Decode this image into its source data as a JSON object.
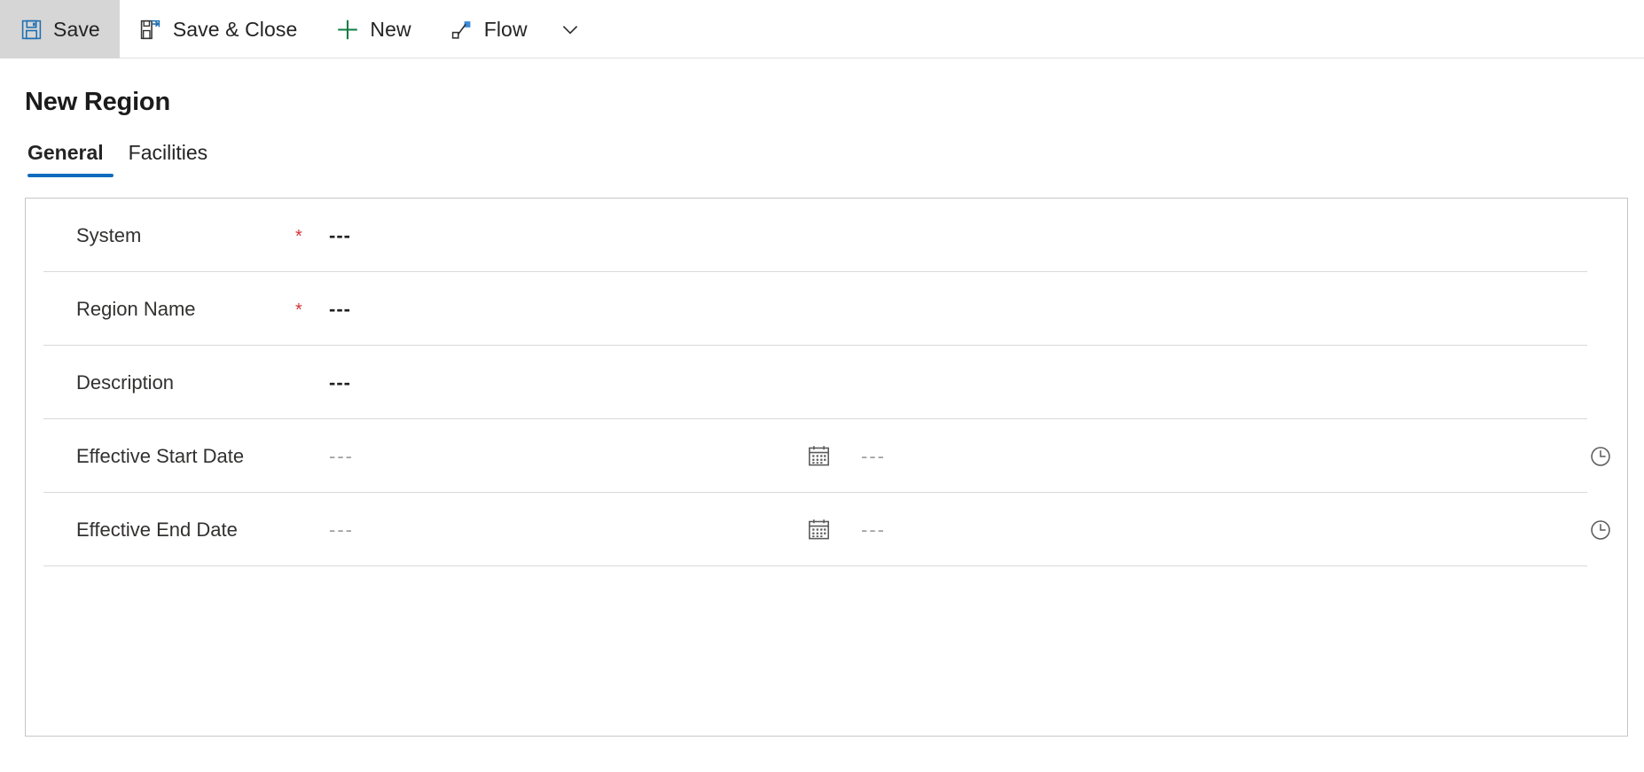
{
  "commandbar": {
    "items": [
      {
        "label": "Save",
        "icon": "save-icon",
        "active": true
      },
      {
        "label": "Save & Close",
        "icon": "save-and-close-icon",
        "active": false
      },
      {
        "label": "New",
        "icon": "plus-icon",
        "active": false
      },
      {
        "label": "Flow",
        "icon": "flow-icon",
        "active": false
      }
    ],
    "overflow_icon": "chevron-down-icon"
  },
  "header": {
    "title": "New Region"
  },
  "tabs": [
    {
      "label": "General",
      "selected": true
    },
    {
      "label": "Facilities",
      "selected": false
    }
  ],
  "form": {
    "rows": [
      {
        "label": "System",
        "required": "*",
        "value": "---",
        "type": "lookup"
      },
      {
        "label": "Region Name",
        "required": "*",
        "value": "---",
        "type": "text"
      },
      {
        "label": "Description",
        "required": "",
        "value": "---",
        "type": "text"
      },
      {
        "label": "Effective Start Date",
        "required": "",
        "value": "---",
        "time_value": "---",
        "type": "datetime",
        "date_icon": "calendar-icon",
        "time_icon": "clock-icon"
      },
      {
        "label": "Effective End Date",
        "required": "",
        "value": "---",
        "time_value": "---",
        "type": "datetime",
        "date_icon": "calendar-icon",
        "time_icon": "clock-icon"
      }
    ]
  },
  "colors": {
    "accent": "#0f6cbd",
    "required": "#d13438",
    "new_icon": "#107c41",
    "text": "#242424",
    "placeholder": "#a19f9d",
    "divider": "#d9d9d9",
    "card_border": "#c8c6c4",
    "active_bg": "#d6d6d6"
  }
}
